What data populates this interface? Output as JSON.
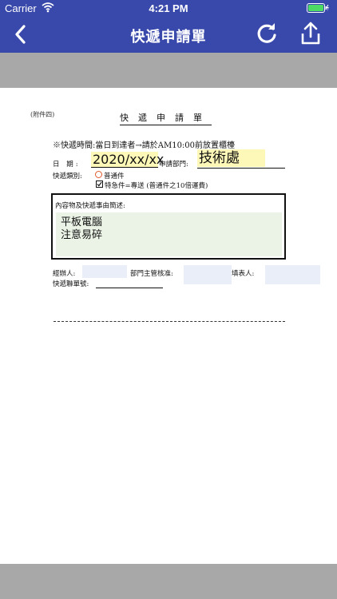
{
  "status_bar": {
    "carrier": "Carrier",
    "time": "4:21 PM"
  },
  "nav": {
    "title": "快遞申請單",
    "back_icon": "chevron-left-icon",
    "refresh_icon": "refresh-icon",
    "share_icon": "share-icon"
  },
  "form": {
    "attachment": "(附件四)",
    "title": "快遞申請單",
    "notice": "※快遞時間:當日到達者→請於AM10:00前放置櫃檯",
    "date_label": "日 期:",
    "date_value": "2020/xx/xx",
    "dept_label": "申請部門:",
    "dept_value": "技術處",
    "type_label": "快遞類別:",
    "type_normal": "普通件",
    "type_urgent": "特急件=專送 (普通件之10倍運費)",
    "type_selected": "urgent",
    "contents_label": "內容物及快遞事由簡述:",
    "contents_lines": [
      "平板電腦",
      "注意易碎"
    ],
    "handler_label": "經辦人:",
    "handler_value": "",
    "approver_label": "部門主管核准:",
    "approver_value": "",
    "filler_label": "填表人:",
    "filler_value": "",
    "tracking_label": "快遞聯單號:",
    "tracking_value": ""
  },
  "colors": {
    "nav_background": "#3949ab",
    "band_gray": "#a8a8a8",
    "highlight_yellow": "#fdf7b8",
    "contents_green": "#eaf3e6",
    "blank_field_blue": "#e9eef9",
    "battery_green": "#4cd964"
  }
}
